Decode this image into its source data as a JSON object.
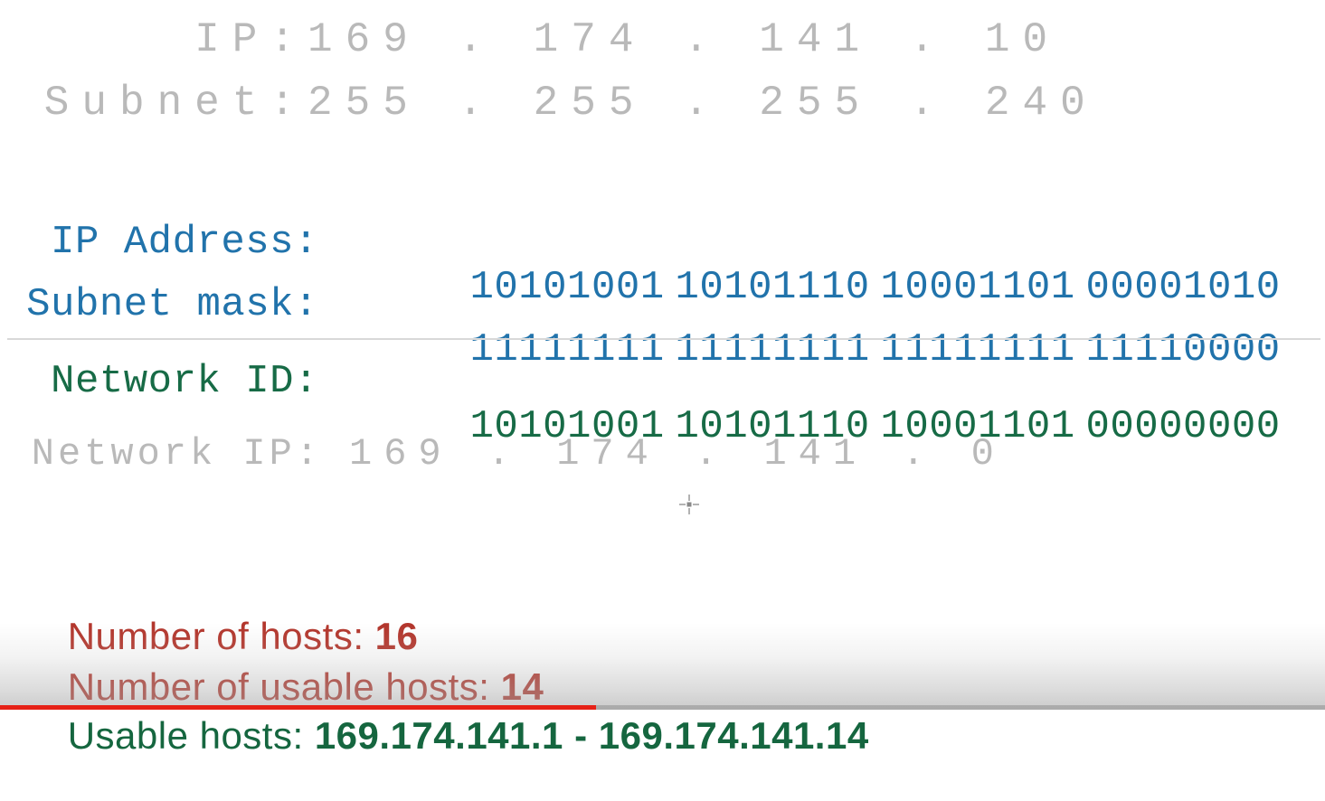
{
  "header": {
    "ip": {
      "label": "IP:",
      "value": "169 . 174 . 141 . 10"
    },
    "subnet": {
      "label": "Subnet:",
      "value": "255 . 255 . 255 . 240"
    }
  },
  "binary": {
    "ip_address": {
      "label": "IP Address:",
      "octets": [
        "10101001",
        "10101110",
        "10001101",
        "00001010"
      ],
      "color": "#2173ab"
    },
    "subnet_mask": {
      "label": "Subnet mask:",
      "octets": [
        "11111111",
        "11111111",
        "11111111",
        "11110000"
      ],
      "color": "#2173ab"
    },
    "network_id": {
      "label": "Network ID:",
      "octets": [
        "10101001",
        "10101110",
        "10001101",
        "00000000"
      ],
      "color": "#176b46"
    }
  },
  "network_ip": {
    "label": "Network IP:",
    "value": "169 . 174 . 141 . 0",
    "color": "#b9b9b9"
  },
  "results": {
    "hosts": {
      "label": "Number of hosts: ",
      "value": "16",
      "color": "#b3352b"
    },
    "usable_hosts_count": {
      "label": "Number of usable hosts: ",
      "value": "14",
      "color": "#b3352b"
    },
    "usable_hosts_range": {
      "label": "Usable hosts: ",
      "value": "169.174.141.1 - 169.174.141.14",
      "color": "#15663f"
    }
  },
  "player": {
    "progress_percent": 45,
    "progress_color": "#e62117",
    "track_color": "#828282"
  }
}
